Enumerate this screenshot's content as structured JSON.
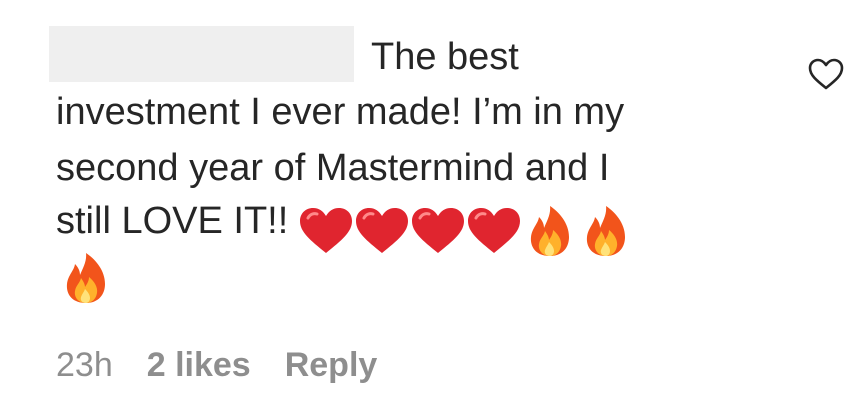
{
  "comment": {
    "line1": "The best",
    "line2": "investment I ever made! I’m in my",
    "line3": "second year of Mastermind and I",
    "line4": "still LOVE IT!!",
    "emojis": [
      "red-heart",
      "red-heart",
      "red-heart",
      "red-heart",
      "fire",
      "fire",
      "fire"
    ]
  },
  "meta": {
    "time": "23h",
    "likes": "2 likes",
    "reply": "Reply"
  },
  "colors": {
    "text": "#262626",
    "muted": "#8e8e8e",
    "heart": "#e0252f",
    "redaction": "#efefef"
  }
}
